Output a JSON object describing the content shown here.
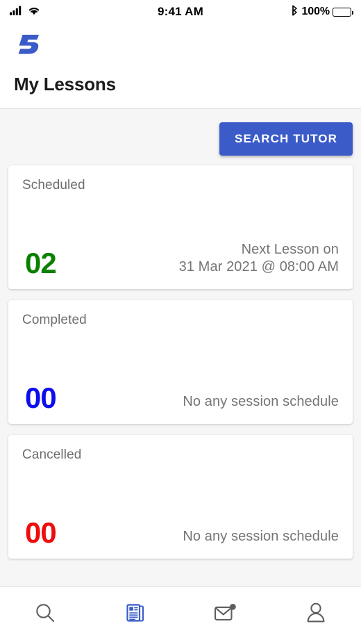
{
  "status_bar": {
    "signal_icon": "cellular-signal-icon",
    "wifi_icon": "wifi-icon",
    "time": "9:41 AM",
    "bluetooth_icon": "bluetooth-icon",
    "battery_percent": "100%",
    "battery_icon": "battery-full-icon"
  },
  "header": {
    "logo_icon": "brand-logo-5-icon",
    "logo_text": "5",
    "title": "My Lessons"
  },
  "toolbar": {
    "search_tutor_label": "SEARCH TUTOR"
  },
  "cards": [
    {
      "label": "Scheduled",
      "count": "02",
      "count_color": "#0a8000",
      "note_line1": "Next Lesson on",
      "note_line2": "31 Mar 2021 @ 08:00 AM"
    },
    {
      "label": "Completed",
      "count": "00",
      "count_color": "#0d0df0",
      "note_line1": "No any session schedule",
      "note_line2": ""
    },
    {
      "label": "Cancelled",
      "count": "00",
      "count_color": "#ee0d0d",
      "note_line1": "No any session schedule",
      "note_line2": ""
    }
  ],
  "bottom_nav": {
    "items": [
      {
        "name": "search",
        "icon": "search-icon",
        "active": false,
        "badge": false
      },
      {
        "name": "lessons",
        "icon": "news-document-icon",
        "active": true,
        "badge": false
      },
      {
        "name": "messages",
        "icon": "mail-envelope-icon",
        "active": false,
        "badge": true
      },
      {
        "name": "profile",
        "icon": "person-icon",
        "active": false,
        "badge": false
      }
    ],
    "active_color": "#3a5bc8",
    "inactive_color": "#5e5e5e"
  },
  "theme": {
    "accent": "#3a5bc8",
    "content_bg": "#f6f6f6",
    "card_bg": "#ffffff",
    "muted_text": "#757575"
  }
}
